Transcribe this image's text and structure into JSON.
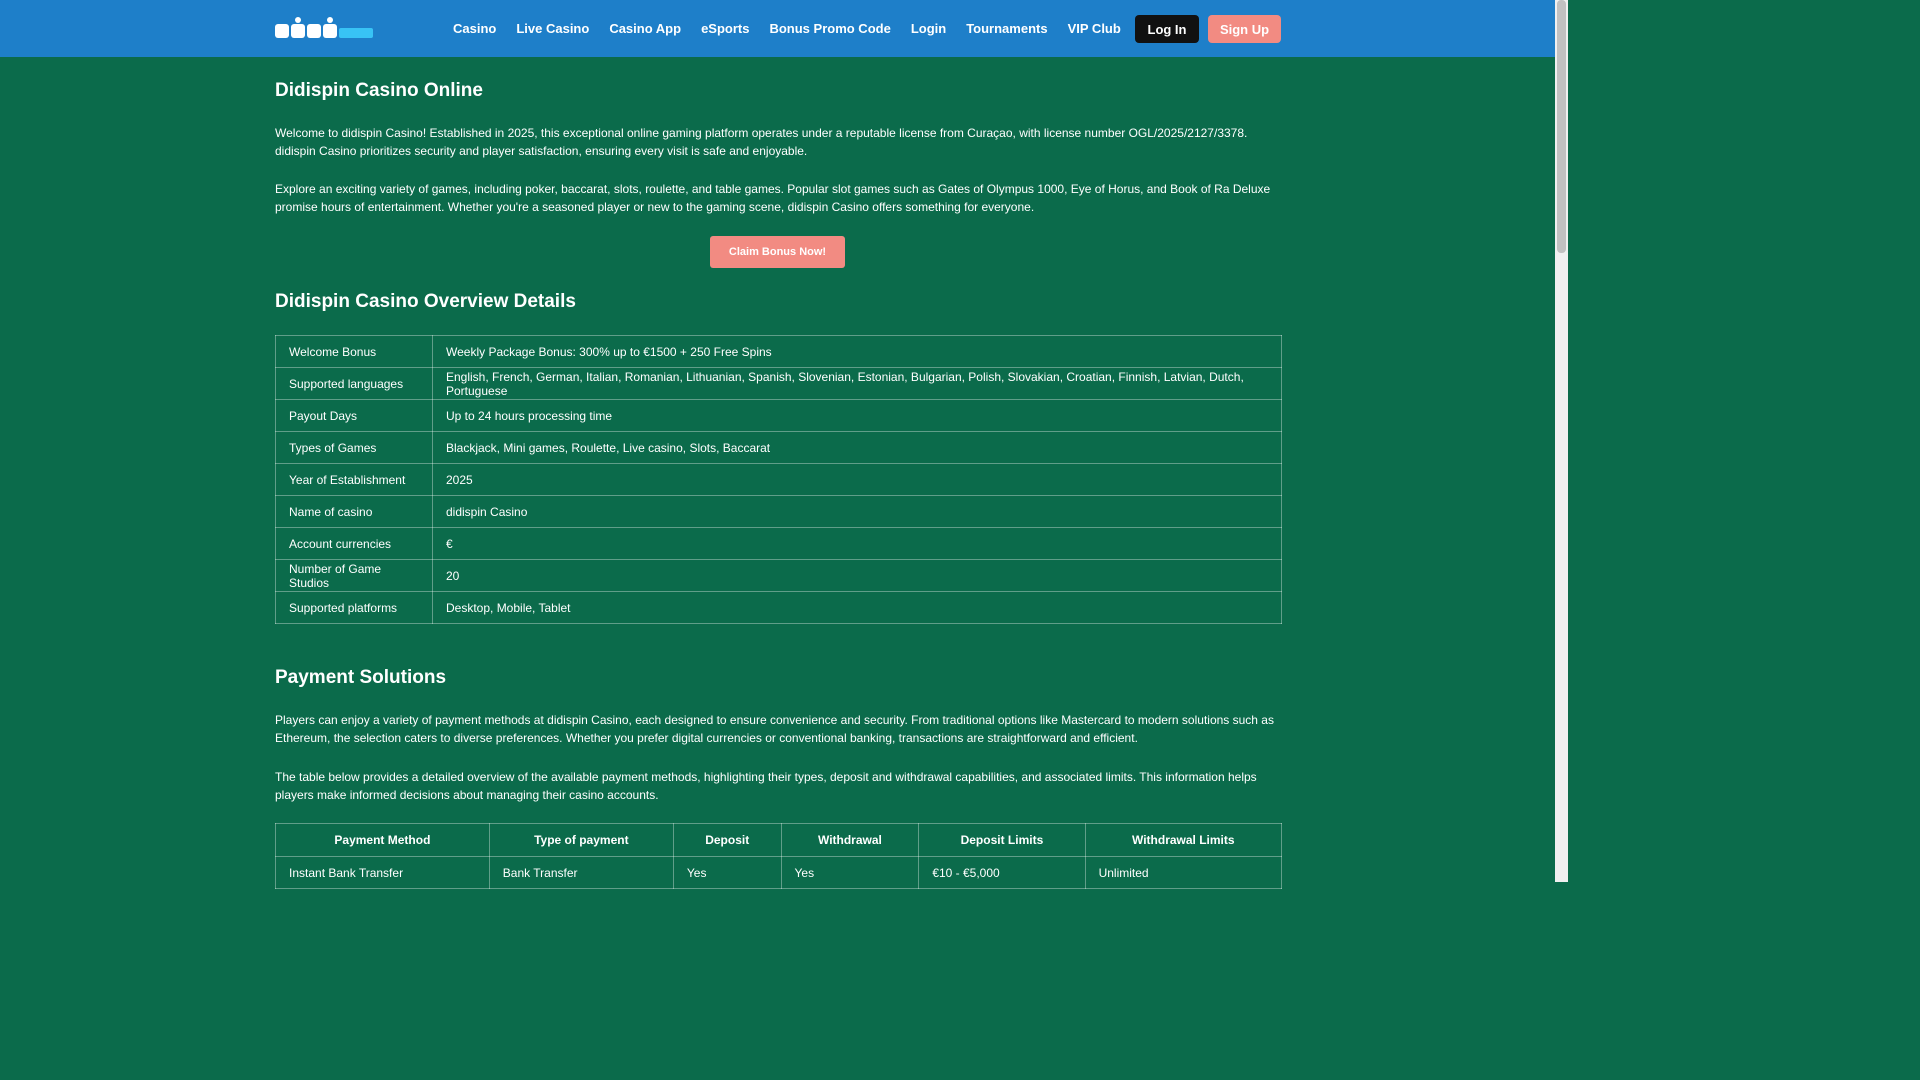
{
  "header": {
    "logo_alt": "didispin",
    "nav": [
      "Casino",
      "Live Casino",
      "Casino App",
      "eSports",
      "Bonus Promo Code",
      "Login",
      "Tournaments",
      "VIP Club"
    ],
    "login_label": "Log In",
    "signup_label": "Sign Up"
  },
  "main": {
    "title": "Didispin Casino Online",
    "intro_1": "Welcome to didispin Casino! Established in 2025, this exceptional online gaming platform operates under a reputable license from Curaçao, with license number OGL/2025/2127/3378. didispin Casino prioritizes security and player satisfaction, ensuring every visit is safe and enjoyable.",
    "intro_2": "Explore an exciting variety of games, including poker, baccarat, slots, roulette, and table games. Popular slot games such as Gates of Olympus 1000, Eye of Horus, and Book of Ra Deluxe promise hours of entertainment. Whether you're a seasoned player or new to the gaming scene, didispin Casino offers something for everyone.",
    "claim_label": "Claim Bonus Now!"
  },
  "overview": {
    "title": "Didispin Casino Overview Details",
    "rows": [
      {
        "key": "Welcome Bonus",
        "value": "Weekly Package Bonus: 300% up to €1500 + 250 Free Spins"
      },
      {
        "key": "Supported languages",
        "value": "English, French, German, Italian, Romanian, Lithuanian, Spanish, Slovenian, Estonian, Bulgarian, Polish, Slovakian, Croatian, Finnish, Latvian, Dutch, Portuguese"
      },
      {
        "key": "Payout Days",
        "value": "Up to 24 hours processing time"
      },
      {
        "key": "Types of Games",
        "value": "Blackjack, Mini games, Roulette, Live casino, Slots, Baccarat"
      },
      {
        "key": "Year of Establishment",
        "value": "2025"
      },
      {
        "key": "Name of casino",
        "value": "didispin Casino"
      },
      {
        "key": "Account currencies",
        "value": "€"
      },
      {
        "key": "Number of Game Studios",
        "value": "20"
      },
      {
        "key": "Supported platforms",
        "value": "Desktop, Mobile, Tablet"
      }
    ]
  },
  "payments": {
    "title": "Payment Solutions",
    "text_1": "Players can enjoy a variety of payment methods at didispin Casino, each designed to ensure convenience and security. From traditional options like Mastercard to modern solutions such as Ethereum, the selection caters to diverse preferences. Whether you prefer digital currencies or conventional banking, transactions are straightforward and efficient.",
    "text_2": "The table below provides a detailed overview of the available payment methods, highlighting their types, deposit and withdrawal capabilities, and associated limits. This information helps players make informed decisions about managing their casino accounts.",
    "columns": [
      "Payment Method",
      "Type of payment",
      "Deposit",
      "Withdrawal",
      "Deposit Limits",
      "Withdrawal Limits"
    ],
    "rows": [
      [
        "Instant Bank Transfer",
        "Bank Transfer",
        "Yes",
        "Yes",
        "€10 - €5,000",
        "Unlimited"
      ]
    ]
  },
  "colors": {
    "header": "#1e7fc9",
    "background": "#0b6b4b",
    "accent": "#f28b82",
    "login": "#111111"
  }
}
